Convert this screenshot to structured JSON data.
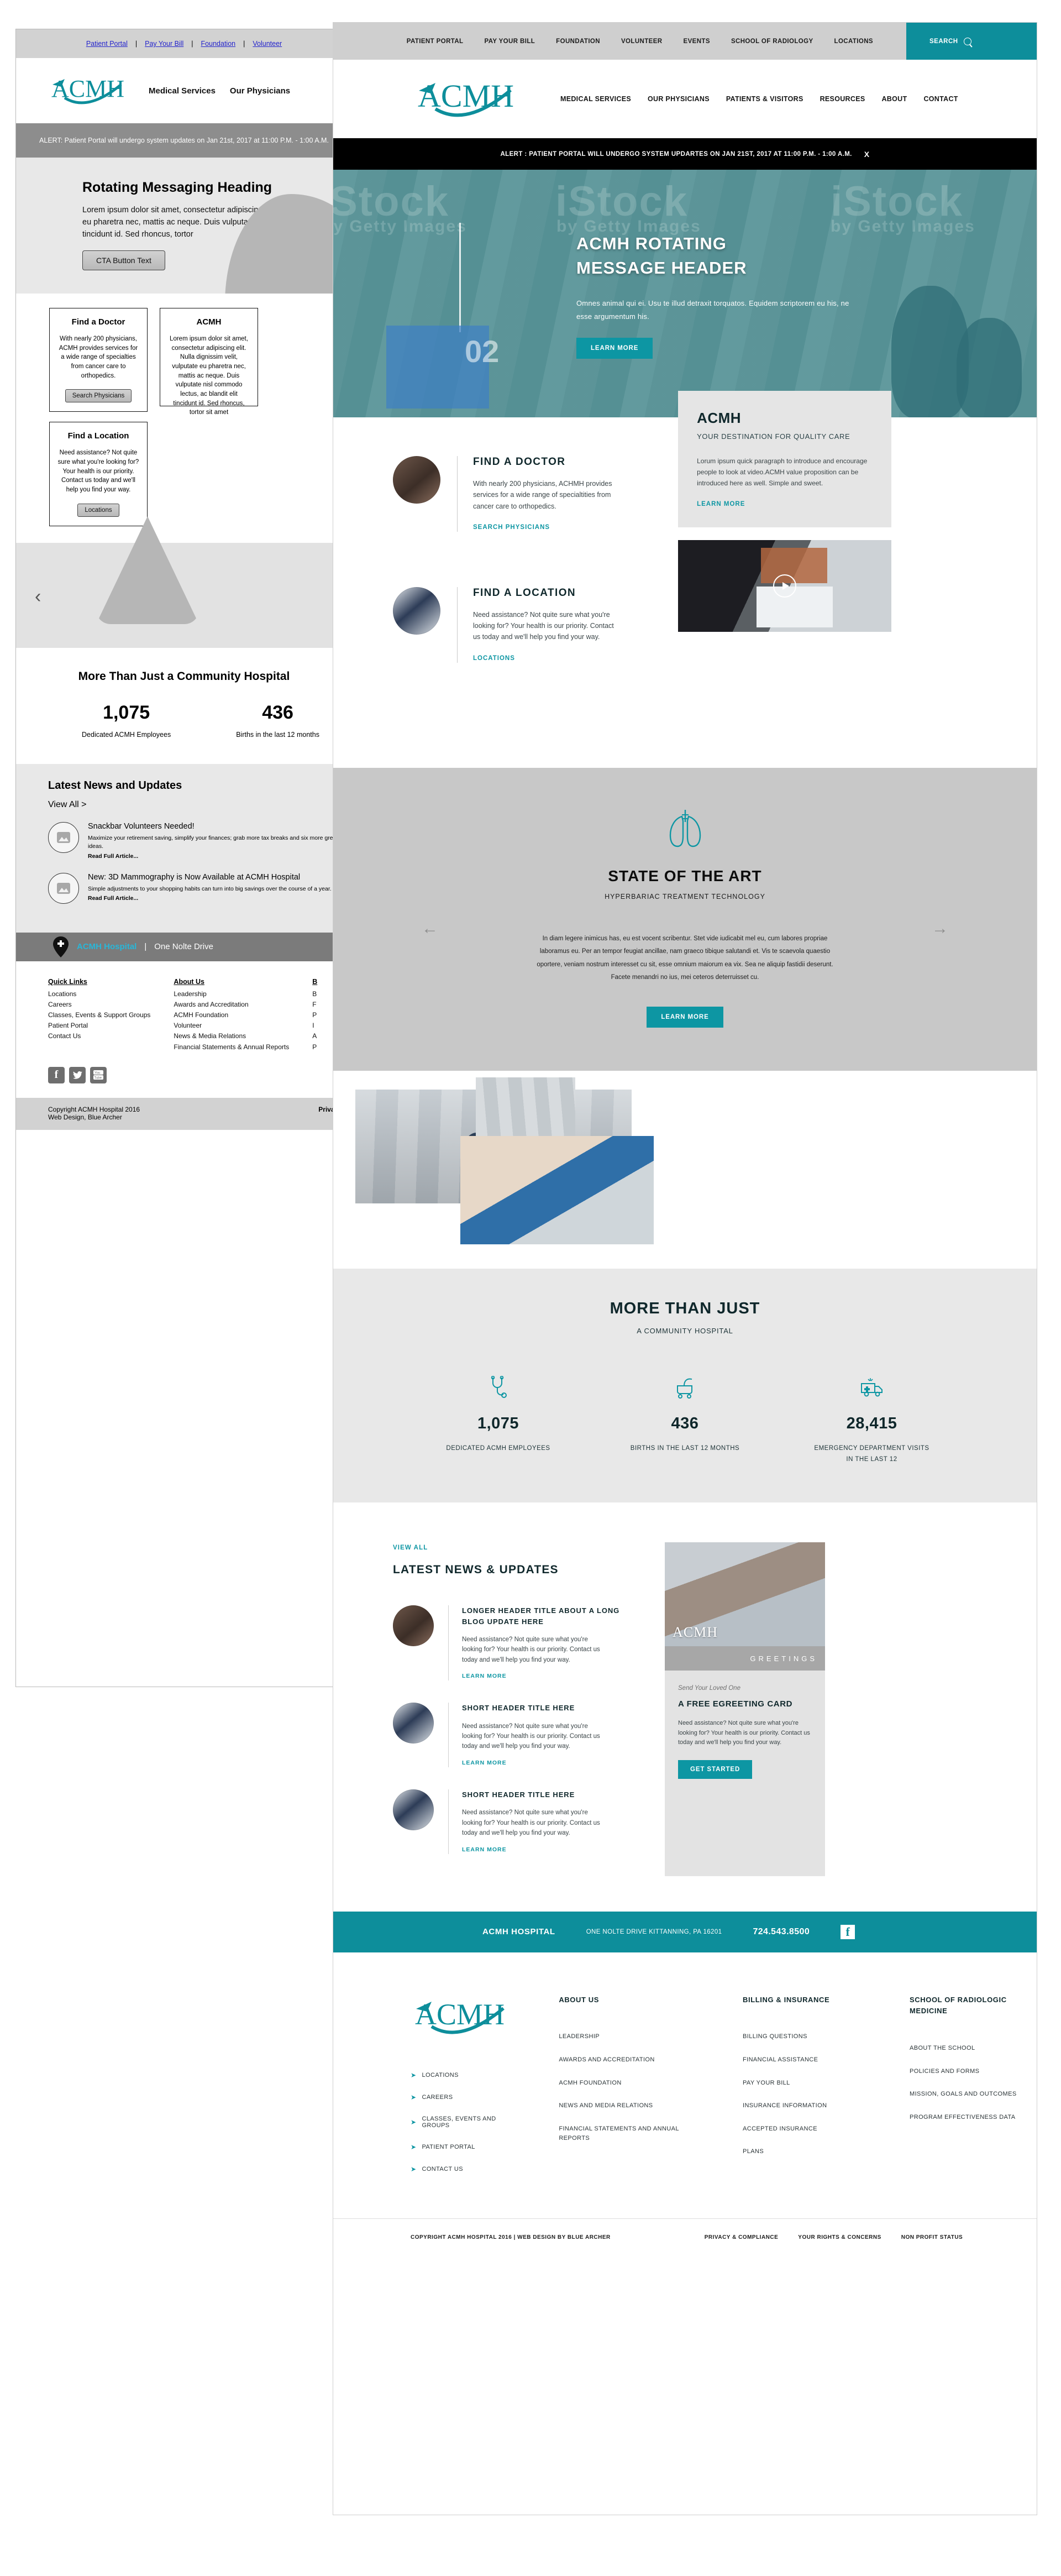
{
  "colors": {
    "teal": "#0d8e9b",
    "teal_link": "#0d96a3",
    "dark": "#10282c",
    "alert_bg": "#000000"
  },
  "old_site": {
    "utility_links": [
      "Patient Portal",
      "Pay Your Bill",
      "Foundation",
      "Volunteer"
    ],
    "nav": [
      "Medical Services",
      "Our Physicians"
    ],
    "logo": "ACMH",
    "alert": "ALERT: Patient Portal will undergo system updates on Jan 21st, 2017 at 11:00 P.M. - 1:00 A.M.",
    "hero": {
      "heading": "Rotating Messaging Heading",
      "body": "Lorem ipsum dolor sit amet, consectetur adipiscing elit. Nulla dignissim velit, vulputate eu pharetra nec, mattis ac neque. Duis vulputate nisl commodo lectus, ac blandit elit tincidunt id. Sed rhoncus, tortor",
      "cta": "CTA Button Text"
    },
    "cards": [
      {
        "title": "Find a Doctor",
        "body": "With nearly 200 physicians, ACMH provides services for a wide range of specialties from cancer care to orthopedics.",
        "button": "Search Physicians"
      },
      {
        "title": "ACMH",
        "body": "Lorem ipsum dolor sit amet, consectetur adipiscing elit. Nulla dignissim velit, vulputate eu pharetra nec, mattis ac neque. Duis vulputate nisl commodo lectus, ac blandit elit tincidunt id. Sed rhoncus, tortor sit amet"
      },
      {
        "title": "Find a Location",
        "body": "Need assistance? Not quite sure what you're looking for? Your health is our priority. Contact us today and we'll help you find your way.",
        "button": "Locations"
      }
    ],
    "stats_heading": "More Than Just a Community Hospital",
    "stats": [
      {
        "number": "1,075",
        "label": "Dedicated ACMH Employees"
      },
      {
        "number": "436",
        "label": "Births in the last 12 months"
      }
    ],
    "news_heading": "Latest News and Updates",
    "view_all": "View All >",
    "news": [
      {
        "title": "Snackbar Volunteers Needed!",
        "body": "Maximize your retirement saving, simplify your finances; grab more tax breaks and six more great ideas.",
        "link": "Read Full Article..."
      },
      {
        "title": "New: 3D Mammography is Now Available at ACMH Hospital",
        "body": "Simple adjustments to your shopping habits can turn into big savings over the course of a year.",
        "link": "Read Full Article..."
      }
    ],
    "address_bar": {
      "name": "ACMH Hospital",
      "separator": "|",
      "address": "One Nolte Drive"
    },
    "footer_columns": [
      {
        "heading": "Quick Links",
        "items": [
          "Locations",
          "Careers",
          "Classes, Events & Support Groups",
          "Patient Portal",
          "Contact Us"
        ]
      },
      {
        "heading": "About Us",
        "items": [
          "Leadership",
          "Awards and Accreditation",
          "ACMH Foundation",
          "Volunteer",
          "News & Media Relations",
          "Financial Statements & Annual Reports"
        ]
      },
      {
        "heading": "B",
        "items": [
          "B",
          "F",
          "P",
          "I",
          "A",
          "P"
        ]
      }
    ],
    "social": [
      "facebook-icon",
      "twitter-icon",
      "youtube-icon"
    ],
    "copyright_left": "Copyright ACMH Hospital 2016\nWeb Design, Blue Archer",
    "copyright_right": "Privacy"
  },
  "mockup": {
    "topbar_links": [
      "PATIENT PORTAL",
      "PAY YOUR BILL",
      "FOUNDATION",
      "VOLUNTEER",
      "EVENTS",
      "SCHOOL OF RADIOLOGY",
      "LOCATIONS"
    ],
    "search_label": "SEARCH",
    "logo": "ACMH",
    "nav": [
      "MEDICAL SERVICES",
      "OUR PHYSICIANS",
      "PATIENTS & VISITORS",
      "RESOURCES",
      "ABOUT",
      "CONTACT"
    ],
    "alert": "ALERT : PATIENT PORTAL WILL UNDERGO SYSTEM UPDARTES ON JAN 21ST, 2017 AT 11:00 P.M. - 1:00 A.M.",
    "alert_close": "X",
    "hero": {
      "heading_line1": "ACMH ROTATING",
      "heading_line2": "MESSAGE HEADER",
      "body": "Omnes animal qui ei. Usu te illud detraxit torquatos. Equidem scriptorem eu his, ne esse argumentum his.",
      "cta": "LEARN MORE",
      "watermark": "iStock",
      "watermark_sub": "by Getty Images",
      "tile_number": "02"
    },
    "features": [
      {
        "title": "FIND A DOCTOR",
        "body": "With nearly 200 physicians, ACHMH provides services for a wide range of specialtities from cancer care to orthopedics.",
        "link": "SEARCH PHYSICIANS"
      },
      {
        "title": "FIND A LOCATION",
        "body": "Need assistance? Not quite sure what you're looking for? Your health is our priority. Contact us today and we'll help you find your way.",
        "link": "LOCATIONS"
      }
    ],
    "promo_card": {
      "title": "ACMH",
      "subtitle": "YOUR DESTINATION FOR QUALITY CARE",
      "body": "Lorum ipsum quick paragraph to introduce and encourage people to look at video.ACMH value proposition can be introduced here as well. Simple and sweet.",
      "link": "LEARN MORE"
    },
    "state_of_art": {
      "icon": "lungs-icon",
      "title": "STATE OF THE ART",
      "subtitle": "HYPERBARIAC TREATMENT TECHNOLOGY",
      "body": "In diam legere inimicus has, eu est vocent scribentur. Stet vide iudicabit mel eu, cum labores propriae laboramus eu. Per an tempor feugiat ancillae, nam graeco tibique salutandi et. Vis te scaevola quaestio oportere, veniam nostrum interesset cu sit, esse omnium maiorum ea vix. Sea ne aliquip fastidii deserunt. Facete menandri no ius, mei ceteros deterruisset cu.",
      "cta": "LEARN MORE",
      "prev": "←",
      "next": "→"
    },
    "stats_section": {
      "title": "MORE THAN JUST",
      "subtitle": "A COMMUNITY HOSPITAL",
      "items": [
        {
          "icon": "stethoscope-icon",
          "number": "1,075",
          "label": "DEDICATED ACMH EMPLOYEES"
        },
        {
          "icon": "bassinet-icon",
          "number": "436",
          "label": "BIRTHS IN THE LAST 12 MONTHS"
        },
        {
          "icon": "ambulance-icon",
          "number": "28,415",
          "label": "EMERGENCY DEPARTMENT VISITS IN THE LAST 12"
        }
      ]
    },
    "news_section": {
      "view_all": "VIEW ALL",
      "title": "LATEST NEWS & UPDATES",
      "items": [
        {
          "title": "LONGER HEADER TITLE ABOUT A LONG BLOG UPDATE HERE",
          "body": "Need assistance? Not quite sure what you're looking for? Your health is our priority. Contact us today and we'll help you find your way.",
          "link": "LEARN MORE"
        },
        {
          "title": "SHORT HEADER TITLE HERE",
          "body": "Need assistance? Not quite sure what you're looking for? Your health is our priority. Contact us today and we'll help you find your way.",
          "link": "LEARN MORE"
        },
        {
          "title": "SHORT HEADER TITLE HERE",
          "body": "Need assistance? Not quite sure what you're looking for? Your health is our priority. Contact us today and we'll help you find your way.",
          "link": "LEARN MORE"
        }
      ]
    },
    "egreeting": {
      "image_logo": "ACMH",
      "band_text": "GREETINGS",
      "eyebrow": "Send Your Loved One",
      "title": "A FREE EGREETING CARD",
      "body": "Need assistance? Not quite sure what you're looking for? Your health is our priority. Contact us today and we'll help you find your way.",
      "cta": "GET STARTED"
    },
    "contact_bar": {
      "name": "ACMH HOSPITAL",
      "address": "ONE NOLTE DRIVE KITTANNING, PA 16201",
      "phone": "724.543.8500",
      "social": "facebook-icon"
    },
    "footer": {
      "logo": "ACMH",
      "quick_links": [
        "LOCATIONS",
        "CAREERS",
        "CLASSES, EVENTS AND GROUPS",
        "PATIENT PORTAL",
        "CONTACT US"
      ],
      "columns": [
        {
          "heading": "ABOUT US",
          "items": [
            "LEADERSHIP",
            "AWARDS AND ACCREDITATION",
            "ACMH FOUNDATION",
            "NEWS AND MEDIA RELATIONS",
            "FINANCIAL STATEMENTS AND ANNUAL REPORTS"
          ]
        },
        {
          "heading": "BILLING & INSURANCE",
          "items": [
            "BILLING QUESTIONS",
            "FINANCIAL ASSISTANCE",
            "PAY YOUR BILL",
            "INSURANCE INFORMATION",
            "ACCEPTED INSURANCE",
            "PLANS"
          ]
        },
        {
          "heading": "SCHOOL OF RADIOLOGIC MEDICINE",
          "items": [
            "ABOUT THE SCHOOL",
            "POLICIES AND FORMS",
            "MISSION, GOALS AND OUTCOMES",
            "PROGRAM EFFECTIVENESS DATA"
          ]
        }
      ],
      "copyright": "COPYRIGHT ACMH HOSPITAL 2016 | WEB DESIGN BY BLUE ARCHER",
      "bottom_links": [
        "PRIVACY & COMPLIANCE",
        "YOUR RIGHTS & CONCERNS",
        "NON PROFIT STATUS"
      ]
    }
  }
}
